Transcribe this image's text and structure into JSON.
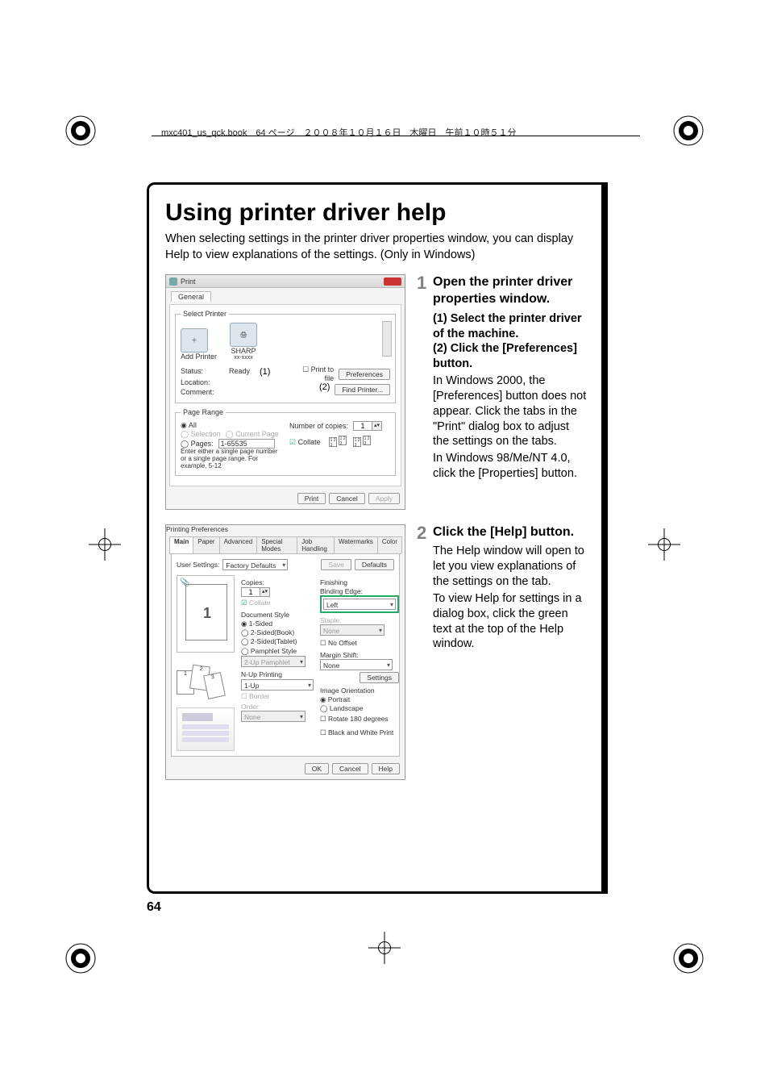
{
  "header_line": "mxc401_us_qck.book　64 ページ　２００８年１０月１６日　木曜日　午前１０時５１分",
  "page_number": "64",
  "title": "Using printer driver help",
  "intro": "When selecting settings in the printer driver properties window, you can display Help to view explanations of the settings. (Only in Windows)",
  "steps": [
    {
      "num": "1",
      "heading": "Open the printer driver properties window.",
      "sub1": "(1) Select the printer driver of the machine.",
      "sub2": "(2) Click the [Preferences] button.",
      "body1": "In Windows 2000, the [Preferences] button does not appear. Click the tabs in the \"Print\" dialog box to adjust the settings on the tabs.",
      "body2": "In Windows 98/Me/NT 4.0, click the [Properties] button."
    },
    {
      "num": "2",
      "heading": "Click the [Help] button.",
      "body1": "The Help window will open to let you view explanations of the settings on the tab.",
      "body2": "To view Help for settings in a dialog box, click the green text at the top of the Help window."
    }
  ],
  "print_dialog": {
    "title": "Print",
    "tab": "General",
    "select_printer_legend": "Select Printer",
    "add_printer": "Add Printer",
    "printer_name": "SHARP",
    "printer_sub": "xx-xxxx",
    "status_k": "Status:",
    "status_v": "Ready",
    "location_k": "Location:",
    "comment_k": "Comment:",
    "callout1": "(1)",
    "print_to_file": "Print to file",
    "preferences_btn": "Preferences",
    "find_printer_btn": "Find Printer...",
    "callout2": "(2)",
    "page_range_legend": "Page Range",
    "all": "All",
    "selection": "Selection",
    "current_page": "Current Page",
    "pages": "Pages:",
    "pages_value": "1-65535",
    "hint": "Enter either a single page number or a single page range.  For example, 5-12",
    "copies_label": "Number of copies:",
    "copies_value": "1",
    "collate": "Collate",
    "collate_seq": "1 2 3",
    "btn_print": "Print",
    "btn_cancel": "Cancel",
    "btn_apply": "Apply"
  },
  "prefs_dialog": {
    "title": "Printing Preferences",
    "tabs": [
      "Main",
      "Paper",
      "Advanced",
      "Special Modes",
      "Job Handling",
      "Watermarks",
      "Color"
    ],
    "user_settings_label": "User Settings:",
    "user_settings_value": "Factory Defaults",
    "btn_save": "Save",
    "btn_defaults": "Defaults",
    "preview_num": "1",
    "copies_label": "Copies:",
    "copies_value": "1",
    "collate": "Collate",
    "doc_style_label": "Document Style",
    "ds_1sided": "1-Sided",
    "ds_2book": "2-Sided(Book)",
    "ds_2tablet": "2-Sided(Tablet)",
    "ds_pamphlet": "Pamphlet Style",
    "pamphlet_dd": "2-Up Pamphlet",
    "nup_label": "N-Up Printing",
    "nup_value": "1-Up",
    "border": "Border",
    "order_label": "Order:",
    "order_value": "None",
    "finishing_label": "Finishing",
    "binding_label": "Binding Edge:",
    "binding_value": "Left",
    "staple_label": "Staple:",
    "staple_value": "None",
    "no_offset": "No Offset",
    "margin_label": "Margin Shift:",
    "margin_value": "None",
    "settings_btn": "Settings",
    "orient_label": "Image Orientation",
    "portrait": "Portrait",
    "landscape": "Landscape",
    "rotate": "Rotate 180 degrees",
    "bw": "Black and White Print",
    "btn_ok": "OK",
    "btn_cancel": "Cancel",
    "btn_help": "Help"
  }
}
